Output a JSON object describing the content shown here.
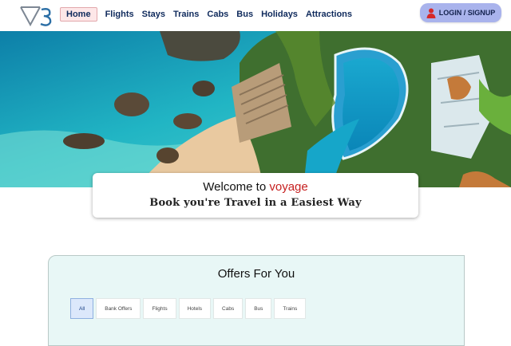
{
  "nav": {
    "logo_text": "V3",
    "links": [
      "Home",
      "Flights",
      "Stays",
      "Trains",
      "Cabs",
      "Bus",
      "Holidays",
      "Attractions"
    ],
    "active": "Home",
    "login_label": "LOGIN / SIGNUP"
  },
  "welcome": {
    "title_prefix": "Welcome to ",
    "brand": "voyage",
    "subtitle": "Book you're Travel in a Easiest Way"
  },
  "offers": {
    "title": "Offers For You",
    "tabs": [
      "All",
      "Bank Offers",
      "Flights",
      "Hotels",
      "Cabs",
      "Bus",
      "Trains"
    ],
    "active_tab": "All"
  },
  "colors": {
    "nav_text": "#0f2a5c",
    "brand": "#c62020",
    "login_bg": "#a9b3ec",
    "offers_bg": "#e8f7f6"
  }
}
